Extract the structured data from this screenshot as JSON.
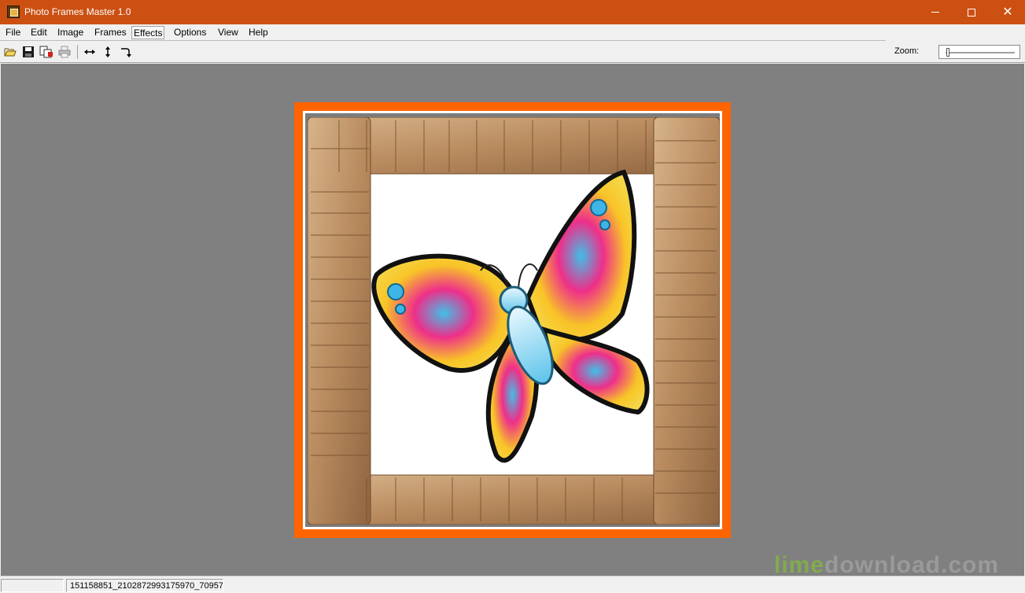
{
  "window": {
    "title": "Photo Frames Master 1.0",
    "minimize_icon": "minimize-icon",
    "maximize_icon": "maximize-icon",
    "close_icon": "close-icon",
    "close_glyph": "✕"
  },
  "menu": {
    "items": [
      {
        "label": "File",
        "underline": "F"
      },
      {
        "label": "Edit",
        "underline": "E"
      },
      {
        "label": "Image",
        "underline": "I"
      },
      {
        "label": "Frames",
        "underline": "F"
      },
      {
        "label": "Effects",
        "underline": "E"
      },
      {
        "label": "Options",
        "underline": "O"
      },
      {
        "label": "View",
        "underline": "V"
      },
      {
        "label": "Help",
        "underline": "H"
      }
    ],
    "active_index": 4
  },
  "toolbar": {
    "buttons": [
      "open-folder-icon",
      "save-icon",
      "copy-icon",
      "print-icon",
      "fit-width-icon",
      "fit-height-icon",
      "rotate-icon"
    ],
    "zoom_label": "Zoom:"
  },
  "canvas": {
    "background_color": "#808080",
    "frame_color": "#ff6400",
    "mat_color": "#ffffff",
    "picture": "butterfly-in-cork-frame"
  },
  "status": {
    "pane1": "",
    "pane2": "151158851_2102872993175970_70957."
  },
  "watermark": {
    "part1": "lime",
    "part2": "download.com"
  },
  "colors": {
    "titlebar": "#cc5012",
    "window_bg": "#f0f0f0"
  }
}
